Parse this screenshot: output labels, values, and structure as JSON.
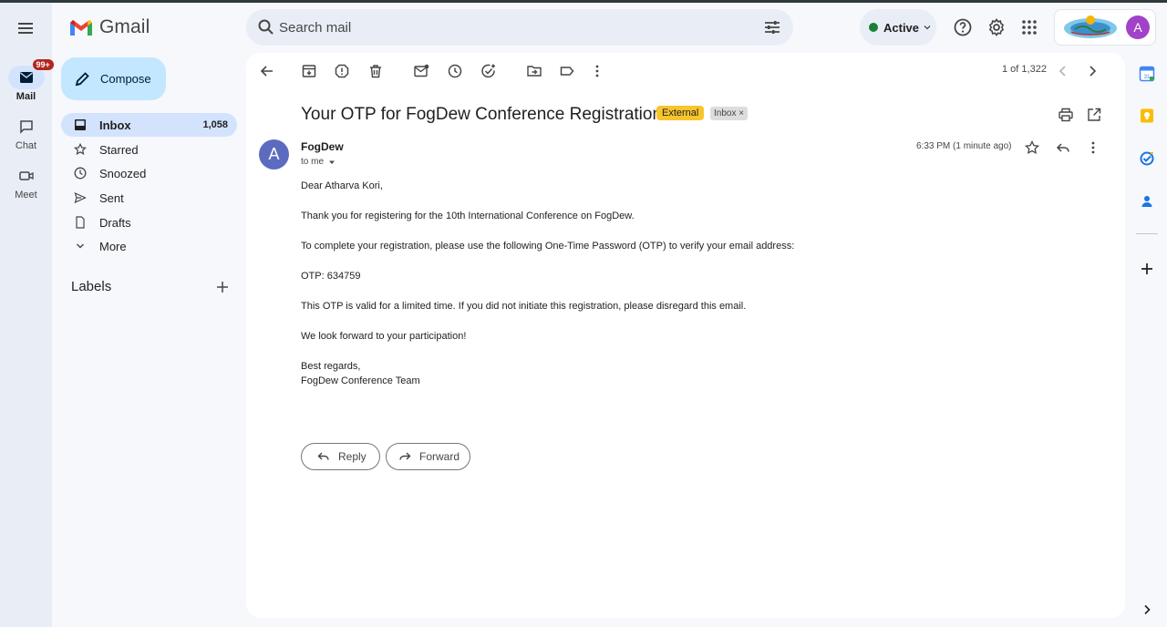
{
  "app": {
    "name": "Gmail",
    "brand_colors": {
      "red": "#ea4335",
      "blue": "#4285f4",
      "green": "#34a853",
      "yellow": "#fbbc04"
    }
  },
  "rail": {
    "items": [
      {
        "label": "Mail",
        "icon": "mail-icon",
        "badge": "99+",
        "active": true
      },
      {
        "label": "Chat",
        "icon": "chat-icon"
      },
      {
        "label": "Meet",
        "icon": "video-icon"
      }
    ]
  },
  "search": {
    "placeholder": "Search mail"
  },
  "status": {
    "label": "Active",
    "color": "#188038"
  },
  "account": {
    "avatar_letter": "A",
    "avatar_color": "#a142c9"
  },
  "sidebar": {
    "compose": "Compose",
    "items": [
      {
        "label": "Inbox",
        "count": "1,058",
        "icon": "inbox-icon",
        "active": true
      },
      {
        "label": "Starred",
        "icon": "star-icon"
      },
      {
        "label": "Snoozed",
        "icon": "clock-icon"
      },
      {
        "label": "Sent",
        "icon": "send-icon"
      },
      {
        "label": "Drafts",
        "icon": "draft-icon"
      },
      {
        "label": "More",
        "icon": "chevron-down-icon"
      }
    ],
    "labels_heading": "Labels"
  },
  "toolbar": {
    "pager": "1 of 1,322"
  },
  "email": {
    "subject": "Your OTP for FogDew Conference Registration",
    "chips": {
      "external": "External",
      "inbox": "Inbox"
    },
    "sender_initial": "A",
    "sender": "FogDew",
    "to": "to me",
    "time": "6:33 PM (1 minute ago)",
    "body": [
      "Dear Atharva Kori,",
      "Thank you for registering for the 10th International Conference on FogDew.",
      "To complete your registration, please use the following One-Time Password (OTP) to verify your email address:",
      "OTP: 634759",
      "This OTP is valid for a limited time. If you did not initiate this registration, please disregard this email.",
      "We look forward to your participation!",
      "Best regards,",
      "FogDew Conference Team"
    ]
  },
  "actions": {
    "reply": "Reply",
    "forward": "Forward"
  }
}
